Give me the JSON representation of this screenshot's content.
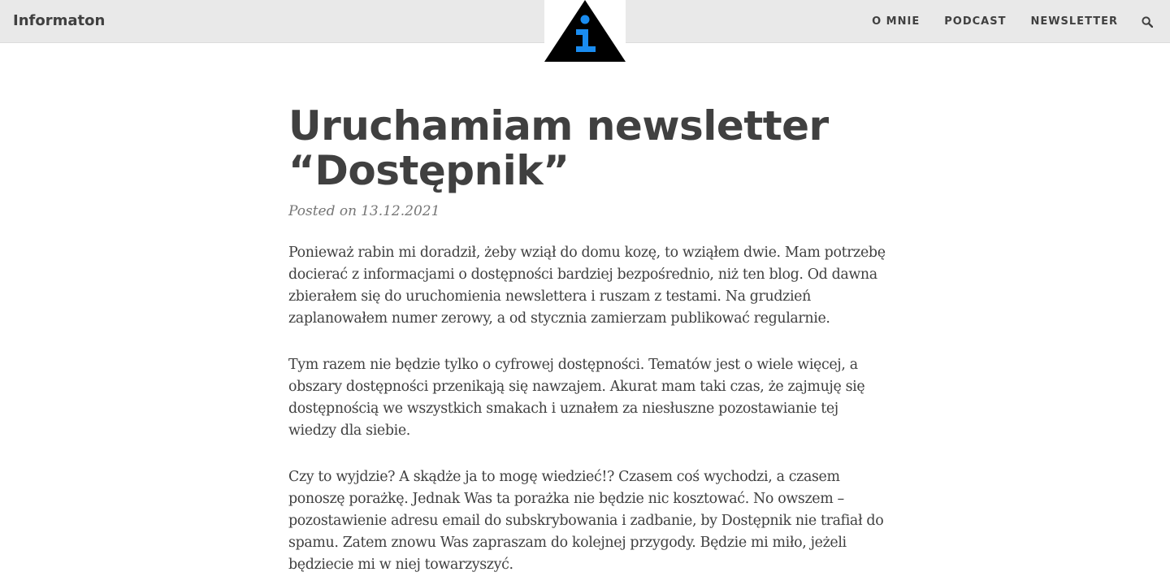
{
  "header": {
    "brand": "Informaton",
    "nav": [
      "O MNIE",
      "PODCAST",
      "NEWSLETTER"
    ],
    "search_icon": "search-icon",
    "logo_colors": {
      "triangle": "#000000",
      "letter": "#1a8cf0"
    }
  },
  "article": {
    "title_line1": "Uruchamiam newsletter",
    "title_line2": "“Dostępnik”",
    "posted_label": "Posted on",
    "date": "13.12.2021",
    "paragraphs": [
      "Ponieważ rabin mi doradził, żeby wziął do domu kozę, to wziąłem dwie. Mam potrzebę docierać z informacjami o dostępności bardziej bezpośrednio, niż ten blog. Od dawna zbierałem się do uruchomienia newslettera i ruszam z testami. Na grudzień zaplanowałem numer zerowy, a od stycznia zamierzam publikować regularnie.",
      "Tym razem nie będzie tylko o cyfrowej dostępności. Tematów jest o wiele więcej, a obszary dostępności przenikają się nawzajem. Akurat mam taki czas, że zajmuję się dostępnością we wszystkich smakach i uznałem za niesłuszne pozostawianie tej wiedzy dla siebie.",
      "Czy to wyjdzie? A skądże ja to mogę wiedzieć!? Czasem coś wychodzi, a czasem ponoszę porażkę. Jednak Was ta porażka nie będzie nic kosztować. No owszem – pozostawienie adresu email do subskrybowania i zadbanie, by Dostępnik nie trafiał do spamu. Zatem znowu Was zapraszam do kolejnej przygody. Będzie mi miło, jeżeli będziecie mi w niej towarzyszyć."
    ]
  }
}
